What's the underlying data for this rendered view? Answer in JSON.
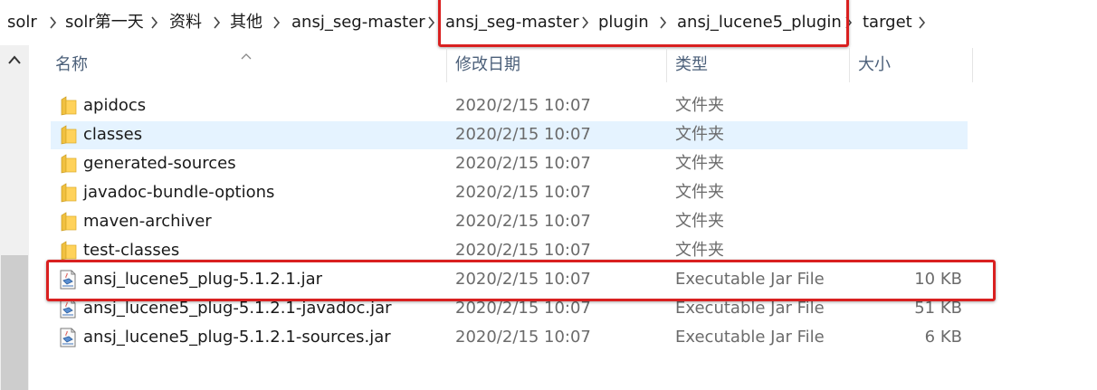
{
  "breadcrumb": [
    "solr",
    "solr第一天",
    "资料",
    "其他",
    "ansj_seg-master",
    "ansj_seg-master",
    "plugin",
    "ansj_lucene5_plugin",
    "target"
  ],
  "columns": {
    "name": "名称",
    "date": "修改日期",
    "type": "类型",
    "size": "大小"
  },
  "files": [
    {
      "name": "apidocs",
      "date": "2020/2/15 10:07",
      "type": "文件夹",
      "size": "",
      "icon": "folder-icon"
    },
    {
      "name": "classes",
      "date": "2020/2/15 10:07",
      "type": "文件夹",
      "size": "",
      "icon": "folder-icon"
    },
    {
      "name": "generated-sources",
      "date": "2020/2/15 10:07",
      "type": "文件夹",
      "size": "",
      "icon": "folder-icon"
    },
    {
      "name": "javadoc-bundle-options",
      "date": "2020/2/15 10:07",
      "type": "文件夹",
      "size": "",
      "icon": "folder-icon"
    },
    {
      "name": "maven-archiver",
      "date": "2020/2/15 10:07",
      "type": "文件夹",
      "size": "",
      "icon": "folder-icon"
    },
    {
      "name": "test-classes",
      "date": "2020/2/15 10:07",
      "type": "文件夹",
      "size": "",
      "icon": "folder-icon"
    },
    {
      "name": "ansj_lucene5_plug-5.1.2.1.jar",
      "date": "2020/2/15 10:07",
      "type": "Executable Jar File",
      "size": "10 KB",
      "icon": "jar-file-icon"
    },
    {
      "name": "ansj_lucene5_plug-5.1.2.1-javadoc.jar",
      "date": "2020/2/15 10:07",
      "type": "Executable Jar File",
      "size": "51 KB",
      "icon": "jar-file-icon"
    },
    {
      "name": "ansj_lucene5_plug-5.1.2.1-sources.jar",
      "date": "2020/2/15 10:07",
      "type": "Executable Jar File",
      "size": "6 KB",
      "icon": "jar-file-icon"
    }
  ],
  "colors": {
    "highlight": "#d92020",
    "selection": "#e5f3ff",
    "header_text": "#4c607a"
  }
}
